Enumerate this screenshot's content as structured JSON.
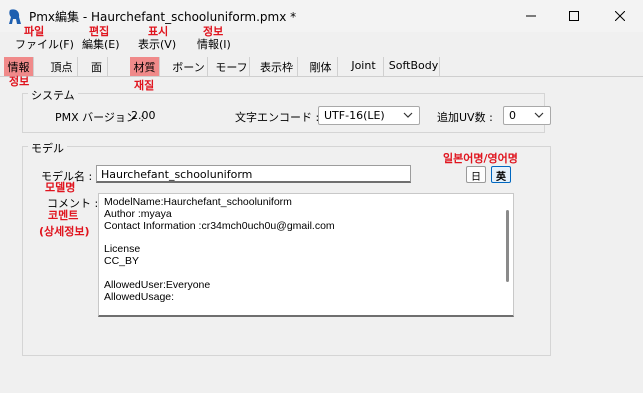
{
  "window": {
    "title": "Pmx編集 - Haurchefant_schooluniform.pmx *"
  },
  "menu": [
    {
      "label": "ファイル(F)"
    },
    {
      "label": "編集(E)"
    },
    {
      "label": "表示(V)"
    },
    {
      "label": "情報(I)"
    }
  ],
  "tabs": [
    {
      "label": "情報",
      "highlight": true
    },
    {
      "label": "頂点"
    },
    {
      "label": "面"
    },
    {
      "label": "材質",
      "highlight": true
    },
    {
      "label": "ボーン"
    },
    {
      "label": "モーフ"
    },
    {
      "label": "表示枠"
    },
    {
      "label": "剛体"
    },
    {
      "label": "Joint"
    },
    {
      "label": "SoftBody"
    }
  ],
  "annotations": {
    "file": "파일",
    "edit": "편집",
    "view": "표시",
    "info": "정보",
    "info_tab": "정보",
    "material_tab": "재질",
    "model_name": "모델명",
    "comment": "코멘트",
    "comment_detail": "(상세정보)",
    "lang_toggle": "일본어명/영어명"
  },
  "system": {
    "title": "システム",
    "pmx_version_label": "PMX バージョン :",
    "pmx_version_value": "2.00",
    "encoding_label": "文字エンコード :",
    "encoding_value": "UTF-16(LE)",
    "uv_label": "追加UV数 :",
    "uv_value": "0"
  },
  "model": {
    "title": "モデル",
    "name_label": "モデル名 :",
    "name_value": "Haurchefant_schooluniform",
    "comment_label": "コメント :",
    "lang_jp": "日",
    "lang_en": "英",
    "comment_lines": [
      "ModelName:Haurchefant_schooluniform",
      "Author :myaya",
      "Contact Information :cr34mch0uch0u@gmail.com",
      "",
      "License",
      "CC_BY",
      "",
      "AllowedUser:Everyone",
      "AllowedUsage:"
    ]
  },
  "colors": {
    "annotation": "#e0141e",
    "tab_highlight": "#f08a8a",
    "accent": "#0067c0"
  }
}
